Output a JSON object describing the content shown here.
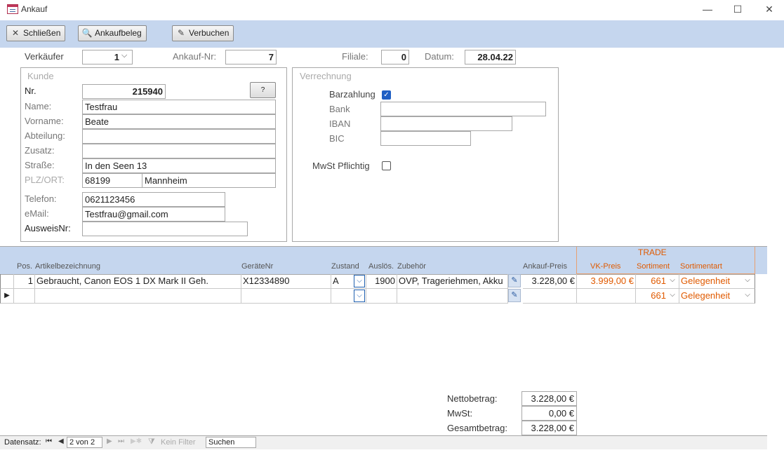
{
  "window": {
    "title": "Ankauf",
    "minimize": "—",
    "maximize": "☐",
    "close": "✕"
  },
  "toolbar": {
    "close_label": "Schließen",
    "receipt_label": "Ankaufbeleg",
    "book_label": "Verbuchen"
  },
  "header": {
    "seller_label": "Verkäufer",
    "seller_value": "1",
    "purchase_no_label": "Ankauf-Nr:",
    "purchase_no_value": "7",
    "branch_label": "Filiale:",
    "branch_value": "0",
    "date_label": "Datum:",
    "date_value": "28.04.22"
  },
  "customer": {
    "group_title": "Kunde",
    "nr_label": "Nr.",
    "nr_value": "215940",
    "lookup_label": "?",
    "name_label": "Name:",
    "name_value": "Testfrau",
    "firstname_label": "Vorname:",
    "firstname_value": "Beate",
    "department_label": "Abteilung:",
    "department_value": "",
    "addition_label": "Zusatz:",
    "addition_value": "",
    "street_label": "Straße:",
    "street_value": "In den Seen 13",
    "zip_city_label": "PLZ/ORT:",
    "zip_value": "68199",
    "city_value": "Mannheim",
    "phone_label": "Telefon:",
    "phone_value": "0621123456",
    "email_label": "eMail:",
    "email_value": "Testfrau@gmail.com",
    "id_label": "AusweisNr:",
    "id_value": ""
  },
  "payment": {
    "group_title": "Verrechnung",
    "cash_label": "Barzahlung",
    "cash_checked": true,
    "bank_label": "Bank",
    "bank_value": "",
    "iban_label": "IBAN",
    "iban_value": "",
    "bic_label": "BIC",
    "bic_value": "",
    "vat_label": "MwSt Pflichtig",
    "vat_checked": false
  },
  "grid": {
    "trade_label": "TRADE",
    "columns": {
      "pos": "Pos.",
      "article": "Artikelbezeichnung",
      "device_no": "GeräteNr",
      "condition": "Zustand",
      "release": "Auslös.",
      "accessories": "Zubehör",
      "purchase_price": "Ankauf-Preis",
      "sale_price": "VK-Preis",
      "assortment": "Sortiment",
      "assortment_type": "Sortimentart"
    },
    "rows": [
      {
        "pos": "1",
        "article": "Gebraucht, Canon EOS 1 DX Mark II Geh.",
        "device_no": "X12334890",
        "condition": "A",
        "release": "1900",
        "accessories": "OVP, Trageriehmen, Akku",
        "purchase_price": "3.228,00 €",
        "sale_price": "3.999,00 €",
        "assortment": "661",
        "assortment_type": "Gelegenheit"
      },
      {
        "pos": "",
        "article": "",
        "device_no": "",
        "condition": "",
        "release": "",
        "accessories": "",
        "purchase_price": "",
        "sale_price": "",
        "assortment": "661",
        "assortment_type": "Gelegenheit"
      }
    ]
  },
  "totals": {
    "net_label": "Nettobetrag:",
    "net_value": "3.228,00 €",
    "vat_label": "MwSt:",
    "vat_value": "0,00 €",
    "gross_label": "Gesamtbetrag:",
    "gross_value": "3.228,00 €"
  },
  "navigation": {
    "record_label": "Datensatz:",
    "record_value": "2 von 2",
    "filter_label": "Kein Filter",
    "search_label": "Suchen"
  },
  "colors": {
    "accent": "#c5d6ee",
    "trade_orange": "#e05a00",
    "checkbox_blue": "#1f5fc4"
  }
}
